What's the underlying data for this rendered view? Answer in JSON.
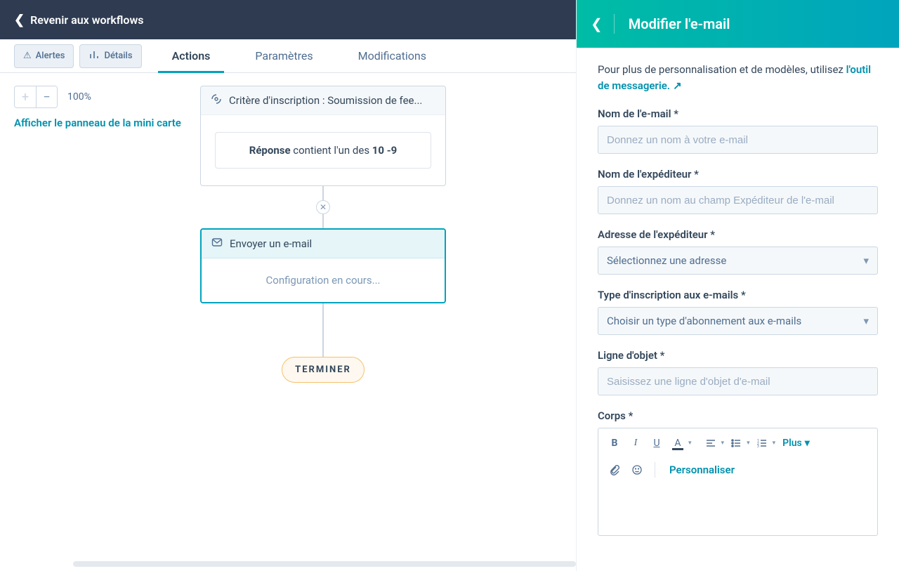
{
  "topbar": {
    "back_label": "Revenir aux workflows"
  },
  "toolbar": {
    "alerts_label": "Alertes",
    "details_label": "Détails"
  },
  "tabs": {
    "actions": "Actions",
    "settings": "Paramètres",
    "modifications": "Modifications"
  },
  "zoom": {
    "percent": "100%"
  },
  "minimap_link": "Afficher le panneau de la mini carte",
  "nodes": {
    "trigger": {
      "header": "Critère d'inscription : Soumission de fee...",
      "filter_prop": "Réponse",
      "filter_mid": " contient l'un des ",
      "filter_val": "10 -9"
    },
    "email": {
      "header": "Envoyer un e-mail",
      "status": "Configuration en cours..."
    },
    "end": "TERMINER"
  },
  "panel": {
    "title": "Modifier l'e-mail",
    "intro_text": "Pour plus de personnalisation et de modèles, utilisez ",
    "intro_link": "l'outil de messagerie.",
    "fields": {
      "name": {
        "label": "Nom de l'e-mail *",
        "placeholder": "Donnez un nom à votre e-mail"
      },
      "sender_name": {
        "label": "Nom de l'expéditeur *",
        "placeholder": "Donnez un nom au champ Expéditeur de l'e-mail"
      },
      "sender_addr": {
        "label": "Adresse de l'expéditeur *",
        "placeholder": "Sélectionnez une adresse"
      },
      "sub_type": {
        "label": "Type d'inscription aux e-mails *",
        "placeholder": "Choisir un type d'abonnement aux e-mails"
      },
      "subject": {
        "label": "Ligne d'objet *",
        "placeholder": "Saisissez une ligne d'objet d'e-mail"
      },
      "body": {
        "label": "Corps *"
      }
    },
    "rte": {
      "more": "Plus",
      "personalize": "Personnaliser"
    }
  }
}
